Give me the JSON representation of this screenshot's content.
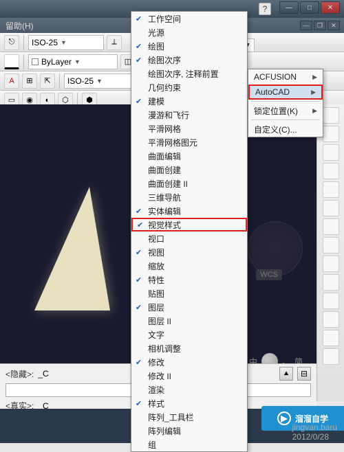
{
  "titlebar": {
    "help_q": "?"
  },
  "menubar": {
    "help": "留助(H)"
  },
  "toolbar": {
    "iso_label": "ISO-25",
    "bylayer": "ByLayer",
    "standard": "ard"
  },
  "check_menu": [
    {
      "label": "工作空间",
      "checked": true
    },
    {
      "label": "光源",
      "checked": false
    },
    {
      "label": "绘图",
      "checked": true
    },
    {
      "label": "绘图次序",
      "checked": true
    },
    {
      "label": "绘图次序, 注释前置",
      "checked": false
    },
    {
      "label": "几何约束",
      "checked": false
    },
    {
      "label": "建模",
      "checked": true
    },
    {
      "label": "漫游和飞行",
      "checked": false
    },
    {
      "label": "平滑网格",
      "checked": false
    },
    {
      "label": "平滑网格图元",
      "checked": false
    },
    {
      "label": "曲面编辑",
      "checked": false
    },
    {
      "label": "曲面创建",
      "checked": false
    },
    {
      "label": "曲面创建 II",
      "checked": false
    },
    {
      "label": "三维导航",
      "checked": false
    },
    {
      "label": "实体编辑",
      "checked": true
    },
    {
      "label": "视觉样式",
      "checked": true,
      "highlighted": true
    },
    {
      "label": "视口",
      "checked": false
    },
    {
      "label": "视图",
      "checked": true
    },
    {
      "label": "缩放",
      "checked": false
    },
    {
      "label": "特性",
      "checked": true
    },
    {
      "label": "贴图",
      "checked": false
    },
    {
      "label": "图层",
      "checked": true
    },
    {
      "label": "图层 II",
      "checked": false
    },
    {
      "label": "文字",
      "checked": false
    },
    {
      "label": "相机调整",
      "checked": false
    },
    {
      "label": "修改",
      "checked": true
    },
    {
      "label": "修改 II",
      "checked": false
    },
    {
      "label": "渲染",
      "checked": false
    },
    {
      "label": "样式",
      "checked": true
    },
    {
      "label": "阵列_工具栏",
      "checked": false
    },
    {
      "label": "阵列编辑",
      "checked": false
    },
    {
      "label": "组",
      "checked": false
    }
  ],
  "sub_menu": {
    "items": [
      {
        "label": "ACFUSION",
        "arrow": true
      },
      {
        "label": "AutoCAD",
        "arrow": true,
        "highlighted": true,
        "hover": true
      }
    ],
    "lock": "锁定位置(K)",
    "custom": "自定义(C)..."
  },
  "wcs": "WCS",
  "bottom": {
    "hidden_label": "<隐藏>:",
    "hidden_value": "_C",
    "real_label": "<真实>:",
    "real_value": "_C"
  },
  "watermark": {
    "text1": "中",
    "text2": "简"
  },
  "zixue": "溜溜自学",
  "username": "jingvan.baru",
  "date": "2012/0/28"
}
